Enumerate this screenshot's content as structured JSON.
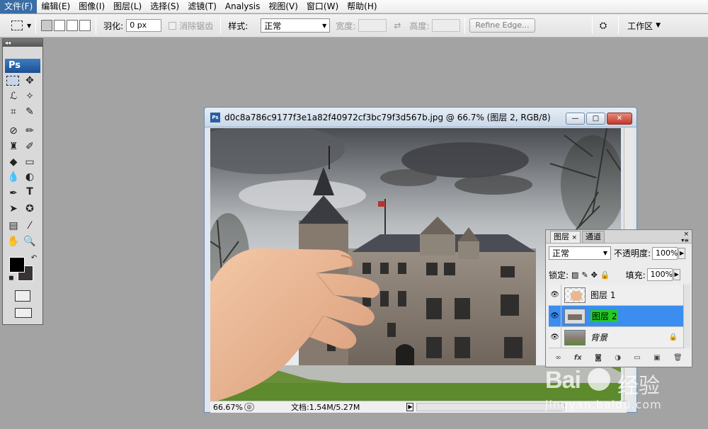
{
  "menu": [
    "文件(F)",
    "编辑(E)",
    "图像(I)",
    "图层(L)",
    "选择(S)",
    "滤镜(T)",
    "Analysis",
    "视图(V)",
    "窗口(W)",
    "帮助(H)"
  ],
  "options": {
    "feather_label": "羽化:",
    "feather_value": "0 px",
    "antialias_label": "消除锯齿",
    "style_label": "样式:",
    "style_value": "正常",
    "width_label": "宽度:",
    "height_label": "高度:",
    "refine_button": "Refine Edge...",
    "workspace_label": "工作区"
  },
  "toolbox": {
    "logo": "Ps"
  },
  "document": {
    "title": "d0c8a786c9177f3e1a82f40972cf3bc79f3d567b.jpg @ 66.7% (图层 2, RGB/8)",
    "zoom": "66.67%",
    "doc_info": "文档:1.54M/5.27M"
  },
  "layers_panel": {
    "tab_layers": "图层",
    "tab_channels": "通道",
    "blend_mode": "正常",
    "opacity_label": "不透明度:",
    "opacity_value": "100%",
    "lock_label": "锁定:",
    "fill_label": "填充:",
    "fill_value": "100%",
    "layers": [
      {
        "name": "图层 1",
        "selected": false
      },
      {
        "name": "图层 2",
        "selected": true
      },
      {
        "name": "背景",
        "selected": false,
        "locked": true
      }
    ]
  },
  "watermark": {
    "brand": "Bai",
    "brand2": "经验",
    "url": "jingyan.baidu.com"
  },
  "colors": {
    "menu_active": "#3a6ea5",
    "layer_selected": "#3b8df0",
    "layer_name_highlight": "#22cc22"
  }
}
